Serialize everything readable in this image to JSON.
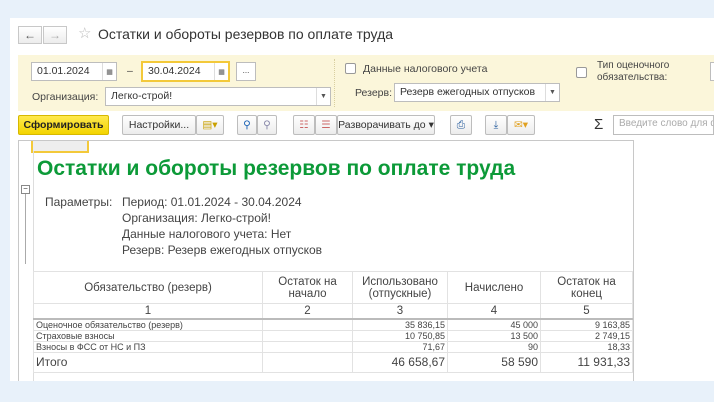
{
  "window": {
    "title": "Остатки и обороты резервов по оплате труда",
    "back": "←",
    "forward": "→",
    "star": "☆"
  },
  "filters": {
    "date_from": "01.01.2024",
    "date_to": "30.04.2024",
    "dash": "–",
    "more": "...",
    "org_label": "Организация:",
    "org_value": "Легко-строй!",
    "tax_label": "Данные налогового учета",
    "reserve_label": "Резерв:",
    "reserve_value": "Резерв ежегодных отпусков",
    "type_label": "Тип оценочного обязательства:"
  },
  "toolbar": {
    "generate": "Сформировать",
    "settings": "Настройки...",
    "expand": "Разворачивать до",
    "search_placeholder": "Введите слово для ф",
    "sigma": "Σ"
  },
  "report": {
    "title": "Остатки и обороты резервов по оплате труда",
    "params_label": "Параметры:",
    "params": [
      "Период: 01.01.2024 - 30.04.2024",
      "Организация: Легко-строй!",
      "Данные налогового учета: Нет",
      "Резерв: Резерв ежегодных отпусков"
    ],
    "headers": [
      "Обязательство (резерв)",
      "Остаток на начало",
      "Использовано (отпускные)",
      "Начислено",
      "Остаток на конец"
    ],
    "col_numbers": [
      "1",
      "2",
      "3",
      "4",
      "5"
    ],
    "rows": [
      {
        "name": "Оценочное обязательство (резерв)",
        "start": "",
        "used": "35 836,15",
        "accrued": "45 000",
        "end": "9 163,85"
      },
      {
        "name": "Страховые взносы",
        "start": "",
        "used": "10 750,85",
        "accrued": "13 500",
        "end": "2 749,15"
      },
      {
        "name": "Взносы в ФСС от НС и ПЗ",
        "start": "",
        "used": "71,67",
        "accrued": "90",
        "end": "18,33"
      }
    ],
    "total": {
      "name": "Итого",
      "start": "",
      "used": "46 658,67",
      "accrued": "58 590",
      "end": "11 931,33"
    }
  }
}
